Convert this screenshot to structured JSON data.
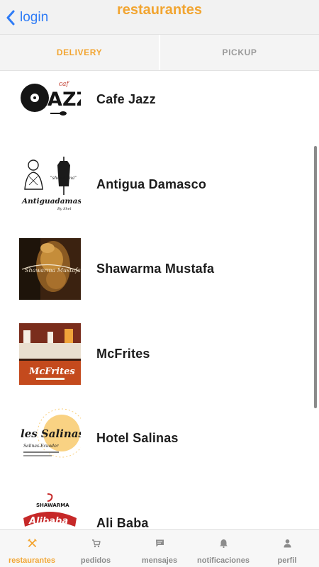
{
  "navbar": {
    "back_label": "login",
    "title": "restaurantes"
  },
  "tabs": [
    {
      "label": "DELIVERY",
      "active": true
    },
    {
      "label": "PICKUP",
      "active": false
    }
  ],
  "restaurants": [
    {
      "name": "Cafe Jazz",
      "logo_text": "JAZZ",
      "logo_subtext": "caf"
    },
    {
      "name": "Antigua Damasco",
      "logo_text": "Antiguadamasco",
      "logo_subtext": "\"shawarma\"",
      "logo_tagline": "By Shel"
    },
    {
      "name": "Shawarma Mustafa",
      "logo_text": "Shawarma Mustafa"
    },
    {
      "name": "McFrites",
      "logo_text": "McFrites"
    },
    {
      "name": "Hotel Salinas",
      "logo_text": "les Salinas",
      "logo_subtext": "Salinas-Ecuador"
    },
    {
      "name": "Ali Baba",
      "logo_text": "Alibaba",
      "logo_subtext": "SHAWARMA"
    }
  ],
  "bottom_tabs": [
    {
      "label": "restaurantes",
      "icon": "utensils-icon",
      "active": true
    },
    {
      "label": "pedidos",
      "icon": "cart-icon",
      "active": false
    },
    {
      "label": "mensajes",
      "icon": "message-icon",
      "active": false
    },
    {
      "label": "notificaciones",
      "icon": "bell-icon",
      "active": false
    },
    {
      "label": "perfil",
      "icon": "user-icon",
      "active": false
    }
  ],
  "colors": {
    "accent": "#f2a531",
    "link": "#2f7cf6",
    "inactive": "#8c8c8c"
  }
}
